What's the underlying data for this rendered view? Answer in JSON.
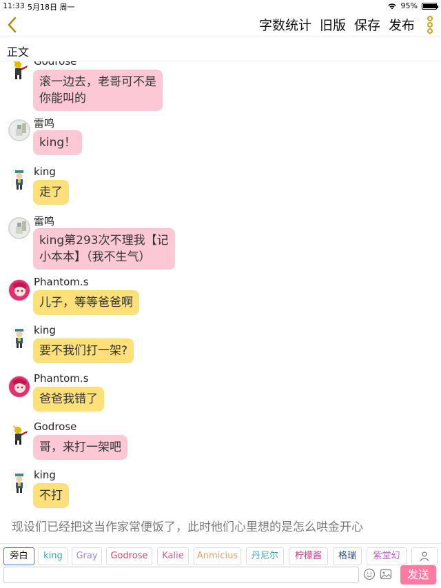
{
  "status": {
    "time": "11:33",
    "date": "5月18日 周一",
    "battery_text": "95%",
    "battery_level": 0.95
  },
  "nav": {
    "actions": [
      "字数统计",
      "旧版",
      "保存",
      "发布"
    ]
  },
  "section": {
    "label": "正文"
  },
  "colors": {
    "pink_bubble": "#fcc8d6",
    "yellow_bubble": "#fde07a",
    "send_button": "#ff7aa2",
    "accent_icon": "#c9a21a"
  },
  "messages": [
    {
      "name": "Godrose",
      "avatar": "godrose-icon",
      "text_lines": [
        "滚一边去，老哥可不是",
        "你能叫的"
      ],
      "color": "pink"
    },
    {
      "name": "雷鸣",
      "avatar": "leiming-icon",
      "text_lines": [
        "king！"
      ],
      "color": "pink"
    },
    {
      "name": "king",
      "avatar": "king-icon",
      "text_lines": [
        "走了"
      ],
      "color": "yellow"
    },
    {
      "name": "雷鸣",
      "avatar": "leiming-icon",
      "text_lines": [
        "king第293次不理我【记",
        "小本本】（我不生气）"
      ],
      "color": "pink"
    },
    {
      "name": "Phantom.s",
      "avatar": "phantom-icon",
      "text_lines": [
        "儿子，等等爸爸啊"
      ],
      "color": "yellow"
    },
    {
      "name": "king",
      "avatar": "king-icon",
      "text_lines": [
        "要不我们打一架?"
      ],
      "color": "yellow"
    },
    {
      "name": "Phantom.s",
      "avatar": "phantom-icon",
      "text_lines": [
        "爸爸我错了"
      ],
      "color": "yellow"
    },
    {
      "name": "Godrose",
      "avatar": "godrose-icon",
      "text_lines": [
        "哥，来打一架吧"
      ],
      "color": "pink"
    },
    {
      "name": "king",
      "avatar": "king-icon",
      "text_lines": [
        "不打"
      ],
      "color": "yellow"
    }
  ],
  "narration": "现设们已经把这当作家常便饭了，此时他们心里想的是怎么哄金开心",
  "characters": [
    {
      "label": "旁白",
      "color": "#111111"
    },
    {
      "label": "king",
      "color": "#3aa7a0"
    },
    {
      "label": "Gray",
      "color": "#9b8bd8"
    },
    {
      "label": "Godrose",
      "color": "#d24a6a"
    },
    {
      "label": "Kalie",
      "color": "#e05a8c"
    },
    {
      "label": "Anmicius",
      "color": "#e0a070"
    },
    {
      "label": "丹尼尔",
      "color": "#4aa0c0"
    },
    {
      "label": "柠檬酱",
      "color": "#c03a8a"
    },
    {
      "label": "格瑞",
      "color": "#2a4a8a"
    },
    {
      "label": "紫堂幻",
      "color": "#c060d0"
    }
  ],
  "composer": {
    "placeholder": "",
    "send_label": "发送"
  }
}
